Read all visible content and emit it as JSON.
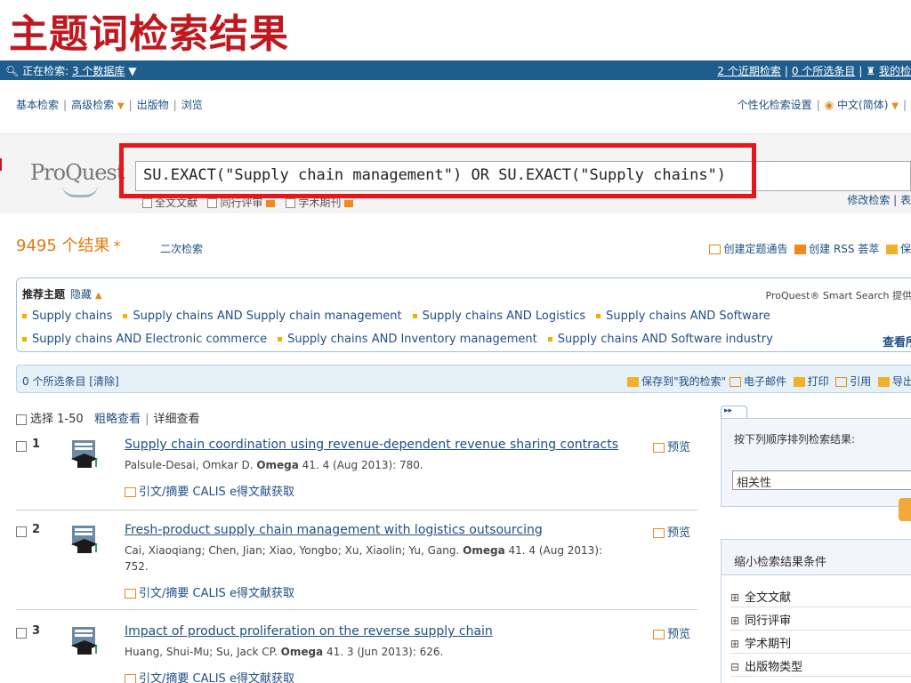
{
  "slide_title": "主题词检索结果",
  "topbar": {
    "searching_prefix": "正在检索:",
    "databases_link": "3 个数据库",
    "recent_searches": "2 个近期检索",
    "selected_items": "0 个所选条目",
    "my_research": "我的检"
  },
  "navbar": {
    "basic": "基本检索",
    "advanced": "高级检索",
    "publications": "出版物",
    "browse": "浏览",
    "preferences": "个性化检索设置",
    "language": "中文(简体)"
  },
  "search": {
    "logo": "ProQuest",
    "query": "SU.EXACT(\"Supply chain management\") OR SU.EXACT(\"Supply chains\")",
    "filters": [
      "全文文献",
      "同行评审",
      "学术期刊"
    ],
    "modify": "修改检索 | 表"
  },
  "results": {
    "count": "9495",
    "count_suffix": "个结果",
    "star": "*",
    "refine": "二次检索",
    "alert": "创建定题通告",
    "rss": "创建 RSS 荟萃",
    "save": "保"
  },
  "topics": {
    "heading": "推荐主题",
    "hide": "隐藏",
    "smart_search": "ProQuest® Smart Search 提供",
    "row1": [
      "Supply chains",
      "Supply chains AND Supply chain management",
      "Supply chains AND Logistics",
      "Supply chains AND Software"
    ],
    "row2": [
      "Supply chains AND Electronic commerce",
      "Supply chains AND Inventory management",
      "Supply chains AND Software industry"
    ],
    "view_all": "查看所"
  },
  "selection_bar": {
    "selected": "0 个所选条目 [清除]",
    "save_to_my_research": "保存到\"我的检索\"",
    "email": "电子邮件",
    "print": "打印",
    "cite": "引用",
    "export": "导出/"
  },
  "list_controls": {
    "select": "选择 1-50",
    "brief_view": "粗略查看",
    "detailed_view": "详细查看"
  },
  "records": [
    {
      "num": "1",
      "title": "Supply chain coordination using revenue-dependent revenue sharing contracts",
      "authors": "Palsule-Desai, Omkar D. ",
      "journal": "Omega",
      "citation": " 41. 4  (Aug 2013): 780.",
      "links": "引文/摘要  CALIS e得文献获取",
      "preview": "预览"
    },
    {
      "num": "2",
      "title": "Fresh-product supply chain management with logistics outsourcing",
      "authors": "Cai, Xiaoqiang; Chen, Jian; Xiao, Yongbo; Xu, Xiaolin; Yu, Gang. ",
      "journal": "Omega",
      "citation": " 41. 4  (Aug 2013): 752.",
      "links": "引文/摘要  CALIS e得文献获取",
      "preview": "预览"
    },
    {
      "num": "3",
      "title": "Impact of product proliferation on the reverse supply chain",
      "authors": "Huang, Shui-Mu; Su, Jack CP. ",
      "journal": "Omega",
      "citation": " 41. 3  (Jun 2013): 626.",
      "links": "引文/摘要  CALIS e得文献获取",
      "preview": "预览"
    }
  ],
  "sidebar": {
    "tab": "▸▸",
    "sort_label": "按下列顺序排列检索结果:",
    "sort_value": "相关性",
    "narrow_title": "缩小检索结果条件",
    "facets": [
      "全文文献",
      "同行评审",
      "学术期刊",
      "出版物类型"
    ]
  },
  "colors": {
    "title_red": "#c0181e",
    "topbar_blue": "#1f5d8c",
    "link_blue": "#1f4f86",
    "highlight_red": "#e8151b",
    "results_orange": "#e07a10"
  }
}
